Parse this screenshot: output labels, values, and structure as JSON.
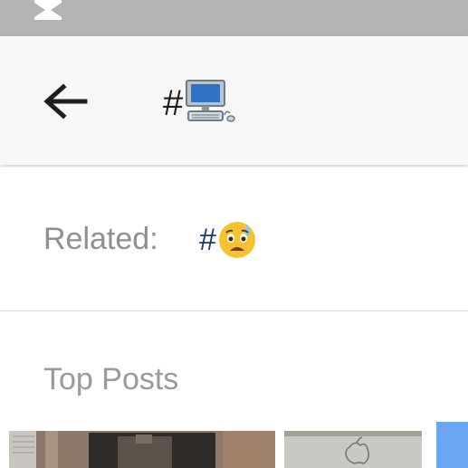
{
  "status_bar": {
    "icon": "hourglass-icon"
  },
  "app_bar": {
    "back_icon": "arrow-left-icon",
    "title_hash": "#",
    "title_emoji": "desktop-computer-emoji"
  },
  "related": {
    "label": "Related:",
    "tag_hash": "#",
    "tag_emoji": "anxious-face-with-sweat-emoji"
  },
  "top_posts": {
    "label": "Top Posts",
    "thumbnails": [
      {
        "name": "post-thumbnail-1"
      },
      {
        "name": "post-thumbnail-2"
      },
      {
        "name": "post-thumbnail-3"
      }
    ]
  },
  "colors": {
    "status_bar": "#b3b3b3",
    "app_bar": "#f7f7f7",
    "label_gray": "#8f8f8f",
    "link_blue": "#1a3a6a",
    "thumb_blue": "#6aa8f0"
  }
}
